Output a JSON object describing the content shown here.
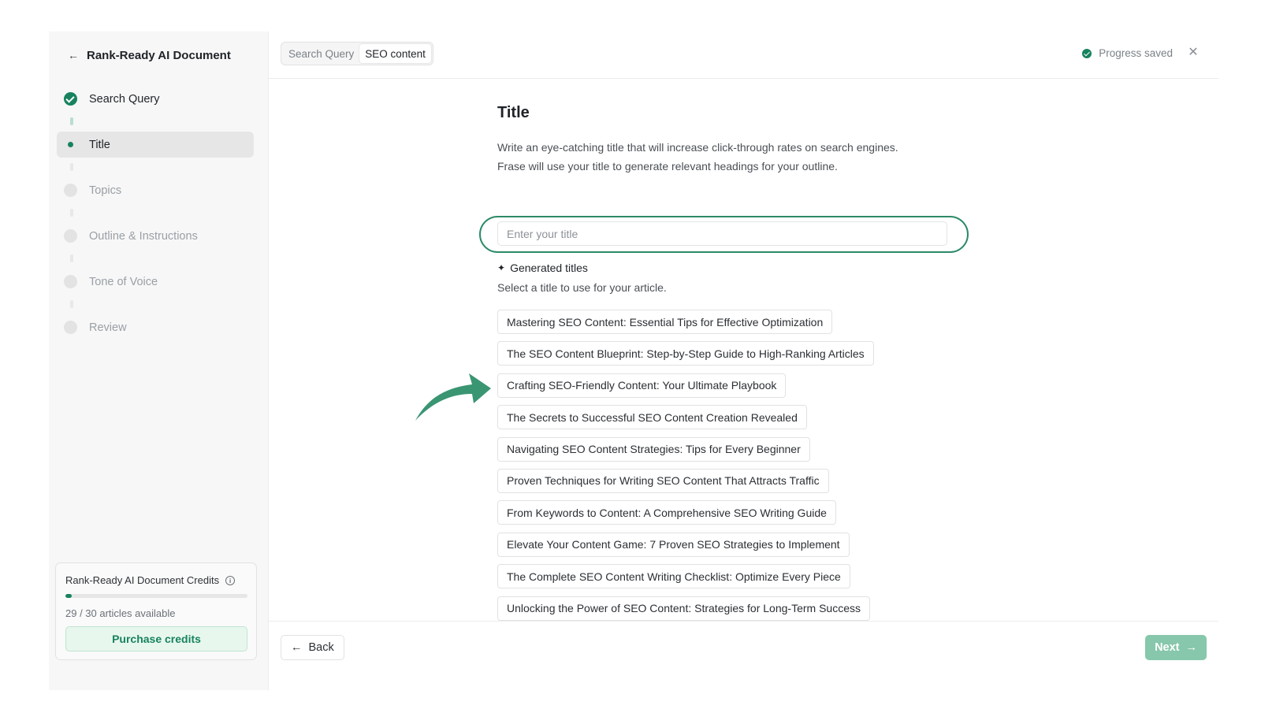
{
  "sidebar": {
    "back_icon": "arrow-left-icon",
    "document_title": "Rank-Ready AI Document",
    "steps": [
      {
        "label": "Search Query",
        "state": "done"
      },
      {
        "label": "Title",
        "state": "active"
      },
      {
        "label": "Topics",
        "state": "pending"
      },
      {
        "label": "Outline & Instructions",
        "state": "pending"
      },
      {
        "label": "Tone of Voice",
        "state": "pending"
      },
      {
        "label": "Review",
        "state": "pending"
      }
    ],
    "credits": {
      "label": "Rank-Ready AI Document Credits",
      "info_icon": "info-icon",
      "used_fraction": 0.033,
      "available_text": "29 / 30 articles available",
      "purchase_label": "Purchase credits"
    }
  },
  "topbar": {
    "tabs": [
      {
        "label": "Search Query",
        "selected": false
      },
      {
        "label": "SEO content",
        "selected": true
      }
    ],
    "status": "Progress saved",
    "close_icon": "close-icon"
  },
  "main": {
    "title": "Title",
    "description_line1": "Write an eye-catching title that will increase click-through rates on search engines.",
    "description_line2": "Frase will use your title to generate relevant headings for your outline.",
    "title_input": {
      "value": "",
      "placeholder": "Enter your title"
    },
    "generated_heading": "Generated titles",
    "generated_subtext": "Select a title to use for your article.",
    "generated_titles": [
      "Mastering SEO Content: Essential Tips for Effective Optimization",
      "The SEO Content Blueprint: Step-by-Step Guide to High-Ranking Articles",
      "Crafting SEO-Friendly Content: Your Ultimate Playbook",
      "The Secrets to Successful SEO Content Creation Revealed",
      "Navigating SEO Content Strategies: Tips for Every Beginner",
      "Proven Techniques for Writing SEO Content That Attracts Traffic",
      "From Keywords to Content: A Comprehensive SEO Writing Guide",
      "Elevate Your Content Game: 7 Proven SEO Strategies to Implement",
      "The Complete SEO Content Writing Checklist: Optimize Every Piece",
      "Unlocking the Power of SEO Content: Strategies for Long-Term Success"
    ]
  },
  "footer": {
    "back_label": "Back",
    "next_label": "Next"
  },
  "colors": {
    "accent": "#17835f",
    "annotation": "#2d8a67",
    "next_disabled": "#87c7ab"
  }
}
